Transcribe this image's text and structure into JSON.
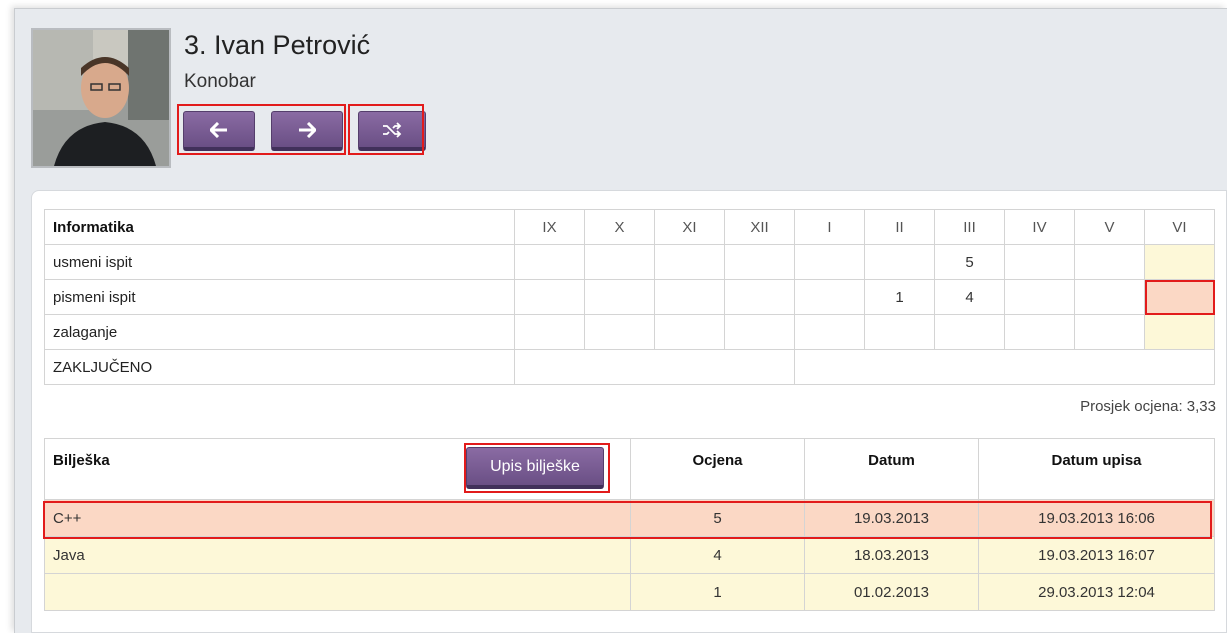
{
  "student": {
    "name": "3. Ivan Petrović",
    "role": "Konobar"
  },
  "icons": {
    "prev": "arrow-left-icon",
    "next": "arrow-right-icon",
    "shuffle": "shuffle-icon"
  },
  "grades_table": {
    "subject": "Informatika",
    "months": [
      "IX",
      "X",
      "XI",
      "XII",
      "I",
      "II",
      "III",
      "IV",
      "V",
      "VI"
    ],
    "rows": [
      {
        "label": "usmeni ispit",
        "values": [
          "",
          "",
          "",
          "",
          "",
          "",
          "5",
          "",
          "",
          ""
        ]
      },
      {
        "label": "pismeni ispit",
        "values": [
          "",
          "",
          "",
          "",
          "",
          "1",
          "4",
          "",
          "",
          ""
        ]
      },
      {
        "label": "zalaganje",
        "values": [
          "",
          "",
          "",
          "",
          "",
          "",
          "",
          "",
          "",
          ""
        ]
      }
    ],
    "final_label": "ZAKLJUČENO"
  },
  "average": "Prosjek ocjena: 3,33",
  "notes_table": {
    "headers": {
      "note": "Bilješka",
      "add_button": "Upis bilješke",
      "grade": "Ocjena",
      "date": "Datum",
      "entry_date": "Datum upisa"
    },
    "rows": [
      {
        "note": "C++",
        "grade": "5",
        "date": "19.03.2013",
        "entry": "19.03.2013 16:06"
      },
      {
        "note": "Java",
        "grade": "4",
        "date": "18.03.2013",
        "entry": "19.03.2013 16:07"
      },
      {
        "note": "",
        "grade": "1",
        "date": "01.02.2013",
        "entry": "29.03.2013 12:04"
      }
    ]
  },
  "colors": {
    "button": "#7a5e96",
    "highlight": "#e21b1b",
    "cream": "#fdf8d8",
    "peach": "#fbd8c5"
  }
}
